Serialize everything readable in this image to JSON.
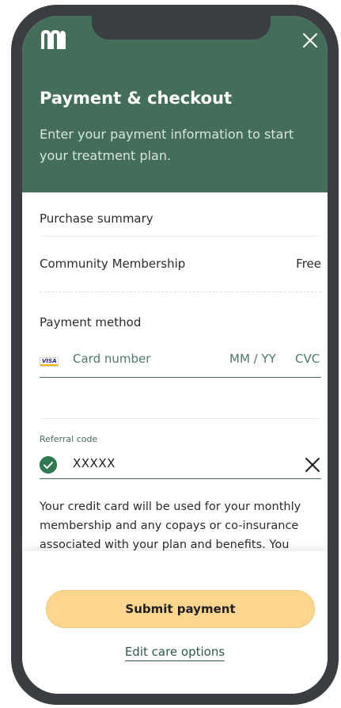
{
  "header": {
    "title": "Payment & checkout",
    "subtitle": "Enter your payment information to start your treatment plan.",
    "background_color": "#446e5a",
    "logo_icon": "brand-logo-m",
    "close_icon": "close-icon"
  },
  "purchase_summary": {
    "heading": "Purchase summary",
    "item_name": "Community Membership",
    "item_price": "Free"
  },
  "payment_method": {
    "heading": "Payment method",
    "card_brand": "VISA",
    "card_number_placeholder": "Card number",
    "expiry_placeholder": "MM / YY",
    "cvc_placeholder": "CVC"
  },
  "referral": {
    "label": "Referral code",
    "value": "XXXXX",
    "status_icon": "check-circle-icon",
    "clear_icon": "close-icon"
  },
  "disclaimer": "Your credit card will be used for your monthly membership and any copays or co-insurance associated with your plan and benefits. You",
  "footer": {
    "submit_label": "Submit payment",
    "edit_label": "Edit care options",
    "submit_color": "#fcd58f"
  }
}
